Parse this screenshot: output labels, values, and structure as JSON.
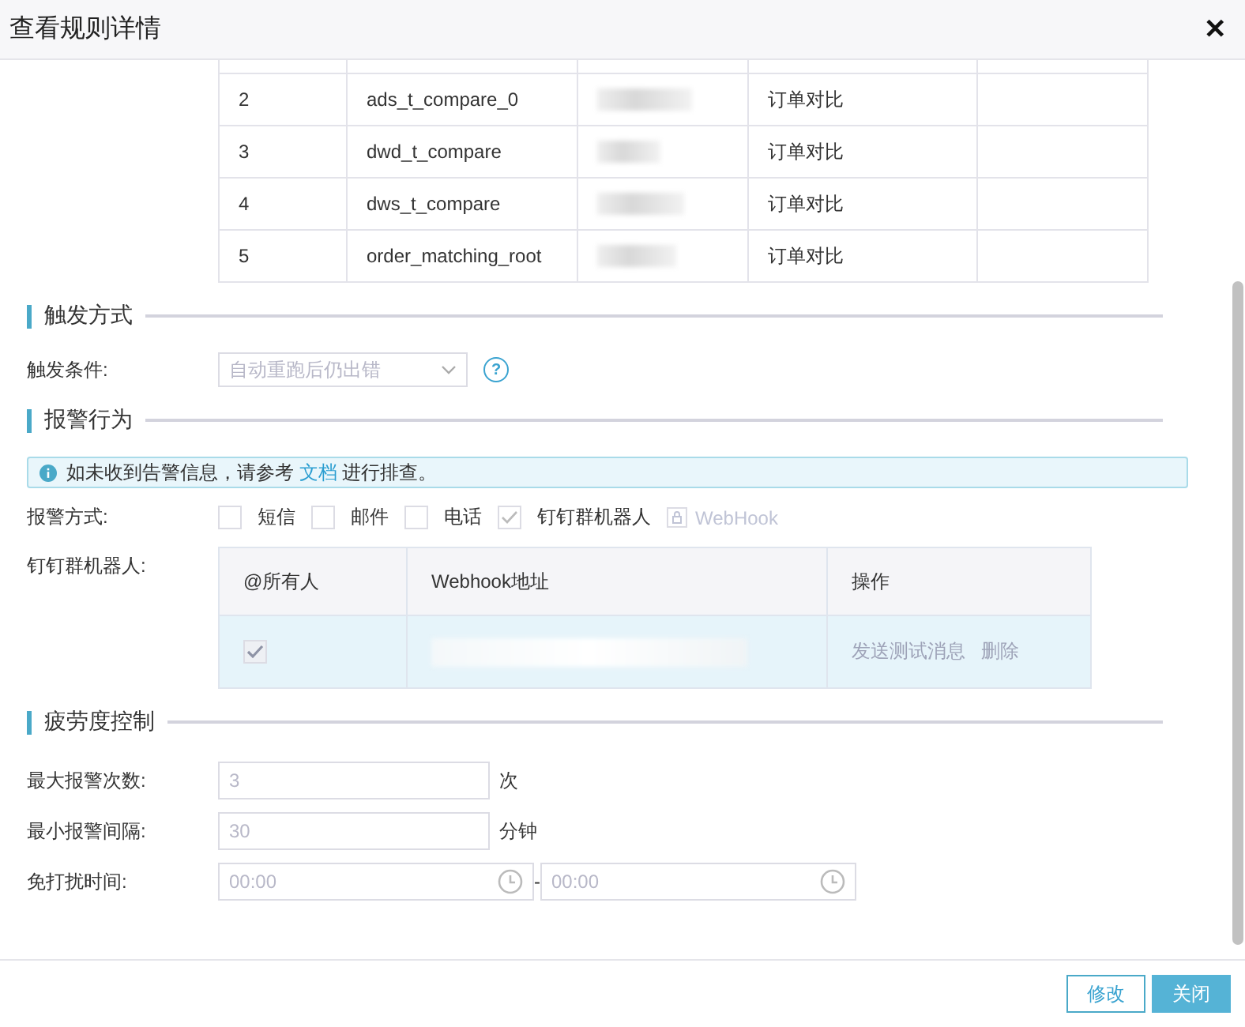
{
  "window": {
    "title": "查看规则详情",
    "close": "✕"
  },
  "objects_table": {
    "rows": [
      {
        "index": "2",
        "name": "ads_t_compare_0",
        "type": "订单对比"
      },
      {
        "index": "3",
        "name": "dwd_t_compare",
        "type": "订单对比"
      },
      {
        "index": "4",
        "name": "dws_t_compare",
        "type": "订单对比"
      },
      {
        "index": "5",
        "name": "order_matching_root",
        "type": "订单对比"
      }
    ]
  },
  "trigger": {
    "heading": "触发方式",
    "label": "触发条件:",
    "value": "自动重跑后仍出错",
    "disabled": true,
    "help": "?"
  },
  "alert": {
    "heading": "报警行为",
    "notice": {
      "before": "如未收到告警信息，请参考 ",
      "link": "文档",
      "after": " 进行排查。"
    },
    "method_label": "报警方式:",
    "methods": [
      {
        "label": "短信",
        "checked": false
      },
      {
        "label": "邮件",
        "checked": false
      },
      {
        "label": "电话",
        "checked": false
      },
      {
        "label": "钉钉群机器人",
        "checked": true
      }
    ],
    "webhook": {
      "label": "WebHook",
      "disabled": true
    },
    "robot_label": "钉钉群机器人:",
    "robot_table": {
      "columns": [
        "@所有人",
        "Webhook地址",
        "操作"
      ],
      "rows": [
        {
          "at_all": true,
          "actions": [
            "发送测试消息",
            "删除"
          ]
        }
      ]
    }
  },
  "fatigue": {
    "heading": "疲劳度控制",
    "fields": [
      {
        "label": "最大报警次数:",
        "value": "3",
        "unit": "次",
        "disabled": true
      },
      {
        "label": "最小报警间隔:",
        "value": "30",
        "unit": "分钟",
        "disabled": true
      }
    ],
    "quiet": {
      "label": "免打扰时间:",
      "start": "00:00",
      "separator": "-",
      "end": "00:00",
      "disabled": true
    }
  },
  "buttons": [
    {
      "label": "修改",
      "kind": "secondary"
    },
    {
      "label": "关闭",
      "kind": "primary"
    }
  ]
}
